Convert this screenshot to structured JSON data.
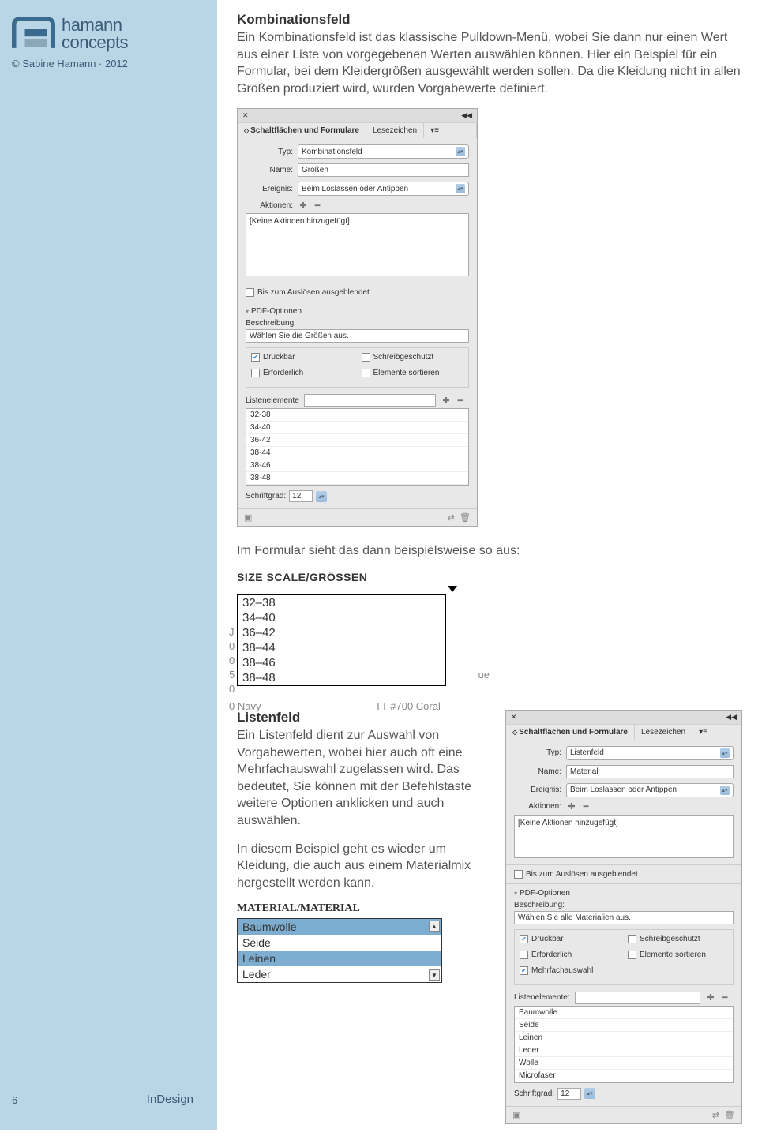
{
  "sidebar": {
    "brand1": "hamann",
    "brand2": "concepts",
    "copyright": "© Sabine Hamann · 2012",
    "page_num": "6",
    "app_name": "InDesign"
  },
  "section1": {
    "title": "Kombinationsfeld",
    "body": "Ein Kombinationsfeld ist das klassische Pulldown-Menü, wobei Sie dann nur einen Wert aus einer Liste von vorgegebenen Werten auswählen können. Hier ein Beispiel für ein Formular, bei dem Kleidergrößen ausgewählt werden sollen. Da die Kleidung nicht in allen Größen produziert wird, wurden Vorgabewerte definiert."
  },
  "panel1": {
    "tab1": "Schaltflächen und Formulare",
    "tab2": "Lesezeichen",
    "typ_label": "Typ:",
    "typ_value": "Kombinationsfeld",
    "name_label": "Name:",
    "name_value": "Größen",
    "ereignis_label": "Ereignis:",
    "ereignis_value": "Beim Loslassen oder Antippen",
    "aktionen_label": "Aktionen:",
    "no_actions": "[Keine Aktionen hinzugefügt]",
    "hidden_until": "Bis zum Auslösen ausgeblendet",
    "pdf_options": "PDF-Optionen",
    "beschreibung_label": "Beschreibung:",
    "beschreibung_value": "Wählen Sie die Größen aus.",
    "opt_druckbar": "Druckbar",
    "opt_erforderlich": "Erforderlich",
    "opt_schreib": "Schreibgeschützt",
    "opt_sortieren": "Elemente sortieren",
    "liste_label": "Listenelemente",
    "items": [
      "32-38",
      "34-40",
      "36-42",
      "38-44",
      "38-46",
      "38-48"
    ],
    "schriftgrad_label": "Schriftgrad:",
    "schriftgrad_value": "12"
  },
  "interlude": "Im Formular sieht das dann beispielsweise so aus:",
  "combo_example": {
    "title": "SIZE SCALE/GRÖSSEN",
    "items": [
      "32–38",
      "34–40",
      "36–42",
      "38–44",
      "38–46",
      "38–48"
    ],
    "bg_left": "0  Navy",
    "bg_right": "TT #700 Coral",
    "bg_ue": "ue"
  },
  "section2": {
    "title": "Listenfeld",
    "body1": "Ein Listenfeld dient zur Auswahl von Vorgabewerten, wobei hier auch oft eine Mehrfachauswahl zugelassen wird. Das bedeutet, Sie können mit der Befehlstaste weitere Optionen anklicken und auch auswählen.",
    "body2": "In diesem Beispiel geht es wieder um Kleidung, die auch aus einem Materialmix hergestellt werden kann."
  },
  "panel2": {
    "tab1": "Schaltflächen und Formulare",
    "tab2": "Lesezeichen",
    "typ_label": "Typ:",
    "typ_value": "Listenfeld",
    "name_label": "Name:",
    "name_value": "Material",
    "ereignis_label": "Ereignis:",
    "ereignis_value": "Beim Loslassen oder Antippen",
    "aktionen_label": "Aktionen:",
    "no_actions": "[Keine Aktionen hinzugefügt]",
    "hidden_until": "Bis zum Auslösen ausgeblendet",
    "pdf_options": "PDF-Optionen",
    "beschreibung_label": "Beschreibung:",
    "beschreibung_value": "Wählen Sie alle Materialien aus.",
    "opt_druckbar": "Druckbar",
    "opt_erforderlich": "Erforderlich",
    "opt_schreib": "Schreibgeschützt",
    "opt_sortieren": "Elemente sortieren",
    "opt_mehrfach": "Mehrfachauswahl",
    "liste_label": "Listenelemente:",
    "items": [
      "Baumwolle",
      "Seide",
      "Leinen",
      "Leder",
      "Wolle",
      "Microfaser"
    ],
    "schriftgrad_label": "Schriftgrad:",
    "schriftgrad_value": "12"
  },
  "material_example": {
    "title": "MATERIAL/MATERIAL",
    "items": [
      "Baumwolle",
      "Seide",
      "Leinen",
      "Leder"
    ],
    "selected": [
      0,
      2
    ]
  }
}
